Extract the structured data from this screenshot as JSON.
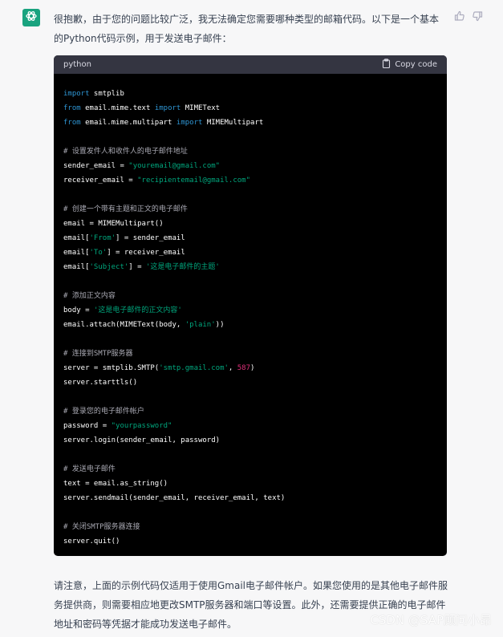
{
  "message": {
    "intro": "很抱歉，由于您的问题比较广泛，我无法确定您需要哪种类型的邮箱代码。以下是一个基本的Python代码示例，用于发送电子邮件：",
    "outro": "请注意，上面的示例代码仅适用于使用Gmail电子邮件帐户。如果您使用的是其他电子邮件服务提供商，则需要相应地更改SMTP服务器和端口等设置。此外，还需要提供正确的电子邮件地址和密码等凭据才能成功发送电子邮件。"
  },
  "code_block": {
    "language": "python",
    "copy_label": "Copy code",
    "lines": [
      [
        {
          "t": "import",
          "c": "kw"
        },
        {
          "t": " smtplib"
        }
      ],
      [
        {
          "t": "from",
          "c": "kw"
        },
        {
          "t": " email.mime.text "
        },
        {
          "t": "import",
          "c": "kw"
        },
        {
          "t": " MIMEText"
        }
      ],
      [
        {
          "t": "from",
          "c": "kw"
        },
        {
          "t": " email.mime.multipart "
        },
        {
          "t": "import",
          "c": "kw"
        },
        {
          "t": " MIMEMultipart"
        }
      ],
      [],
      [
        {
          "t": "# 设置发件人和收件人的电子邮件地址",
          "c": "cm"
        }
      ],
      [
        {
          "t": "sender_email = "
        },
        {
          "t": "\"youremail@gmail.com\"",
          "c": "str"
        }
      ],
      [
        {
          "t": "receiver_email = "
        },
        {
          "t": "\"recipientemail@gmail.com\"",
          "c": "str"
        }
      ],
      [],
      [
        {
          "t": "# 创建一个带有主题和正文的电子邮件",
          "c": "cm"
        }
      ],
      [
        {
          "t": "email = MIMEMultipart()"
        }
      ],
      [
        {
          "t": "email["
        },
        {
          "t": "'From'",
          "c": "str"
        },
        {
          "t": "] = sender_email"
        }
      ],
      [
        {
          "t": "email["
        },
        {
          "t": "'To'",
          "c": "str"
        },
        {
          "t": "] = receiver_email"
        }
      ],
      [
        {
          "t": "email["
        },
        {
          "t": "'Subject'",
          "c": "str"
        },
        {
          "t": "] = "
        },
        {
          "t": "'这是电子邮件的主题'",
          "c": "str"
        }
      ],
      [],
      [
        {
          "t": "# 添加正文内容",
          "c": "cm"
        }
      ],
      [
        {
          "t": "body = "
        },
        {
          "t": "'这是电子邮件的正文内容'",
          "c": "str"
        }
      ],
      [
        {
          "t": "email.attach(MIMEText(body, "
        },
        {
          "t": "'plain'",
          "c": "str"
        },
        {
          "t": "))"
        }
      ],
      [],
      [
        {
          "t": "# 连接到SMTP服务器",
          "c": "cm"
        }
      ],
      [
        {
          "t": "server = smtplib.SMTP("
        },
        {
          "t": "'smtp.gmail.com'",
          "c": "str"
        },
        {
          "t": ", "
        },
        {
          "t": "587",
          "c": "num"
        },
        {
          "t": ")"
        }
      ],
      [
        {
          "t": "server.starttls()"
        }
      ],
      [],
      [
        {
          "t": "# 登录您的电子邮件帐户",
          "c": "cm"
        }
      ],
      [
        {
          "t": "password = "
        },
        {
          "t": "\"yourpassword\"",
          "c": "str"
        }
      ],
      [
        {
          "t": "server.login(sender_email, password)"
        }
      ],
      [],
      [
        {
          "t": "# 发送电子邮件",
          "c": "cm"
        }
      ],
      [
        {
          "t": "text = email.as_string()"
        }
      ],
      [
        {
          "t": "server.sendmail(sender_email, receiver_email, text)"
        }
      ],
      [],
      [
        {
          "t": "# 关闭SMTP服务器连接",
          "c": "cm"
        }
      ],
      [
        {
          "t": "server.quit()"
        }
      ]
    ]
  },
  "watermark": "CSDN @SAP顾问小昂",
  "colors": {
    "avatar": "#19a37f",
    "code_bg": "#000000",
    "code_header": "#343541",
    "keyword": "#2e95d3",
    "string": "#00a67d",
    "number": "#df3079",
    "comment": "#a9a9b3"
  },
  "icons": {
    "avatar": "openai-logo-icon",
    "thumbs_up": "thumbs-up-icon",
    "thumbs_down": "thumbs-down-icon",
    "copy": "clipboard-icon"
  }
}
